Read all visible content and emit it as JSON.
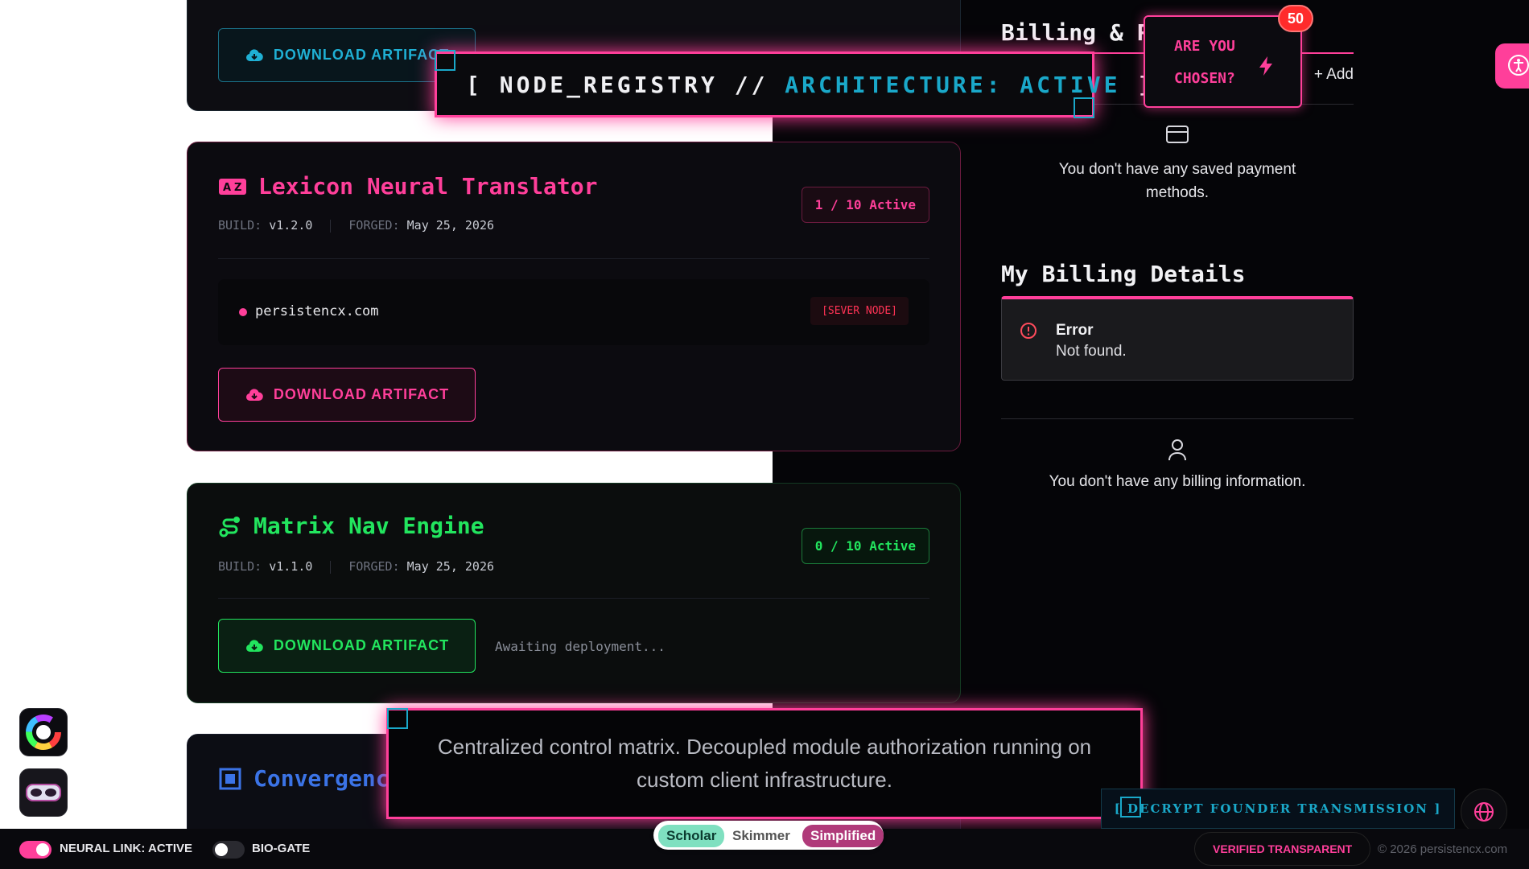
{
  "colors": {
    "pink": "#ff3f9a",
    "cyan": "#1aa8c9",
    "green": "#22e55e",
    "blue": "#3b73e6"
  },
  "top_card": {
    "download_label": "DOWNLOAD ARTIFACT"
  },
  "registry_banner": {
    "prefix": "[ NODE_REGISTRY // ",
    "status": "ARCHITECTURE: ACTIVE",
    "suffix": " ]"
  },
  "modules": [
    {
      "title": "Lexicon Neural Translator",
      "icon": "translate-icon",
      "build_label": "BUILD:",
      "build": "v1.2.0",
      "forged_label": "FORGED:",
      "forged": "May 25, 2026",
      "badge": "1 / 10 Active",
      "node": {
        "domain": "persistencx.com",
        "sever_label": "[SEVER NODE]"
      },
      "download_label": "DOWNLOAD ARTIFACT"
    },
    {
      "title": "Matrix Nav Engine",
      "icon": "route-icon",
      "build_label": "BUILD:",
      "build": "v1.1.0",
      "forged_label": "FORGED:",
      "forged": "May 25, 2026",
      "badge": "0 / 10 Active",
      "download_label": "DOWNLOAD ARTIFACT",
      "status": "Awaiting deployment..."
    },
    {
      "title": "Convergence",
      "icon": "frame-icon"
    }
  ],
  "billing": {
    "payment_title": "Billing & P",
    "add_label": "+ Add",
    "no_payment": "You don't have any saved payment methods.",
    "details_title": "My Billing Details",
    "error_title": "Error",
    "error_msg": "Not found.",
    "no_billing": "You don't have any billing information."
  },
  "chosen_popup": {
    "line1": "ARE YOU",
    "line2": "CHOSEN?",
    "count": "50"
  },
  "tagline": {
    "text": "Centralized control matrix. Decoupled module authorization running on custom client infrastructure."
  },
  "decrypt_button": "[ DECRYPT FOUNDER TRANSMISSION ]",
  "reading_modes": [
    "Scholar",
    "Skimmer",
    "Simplified"
  ],
  "toggles": {
    "neural_link": "NEURAL LINK: ACTIVE",
    "bio_gate": "BIO-GATE"
  },
  "footer": {
    "verified": "VERIFIED TRANSPARENT",
    "copyright": "© 2026 persistencx.com"
  }
}
